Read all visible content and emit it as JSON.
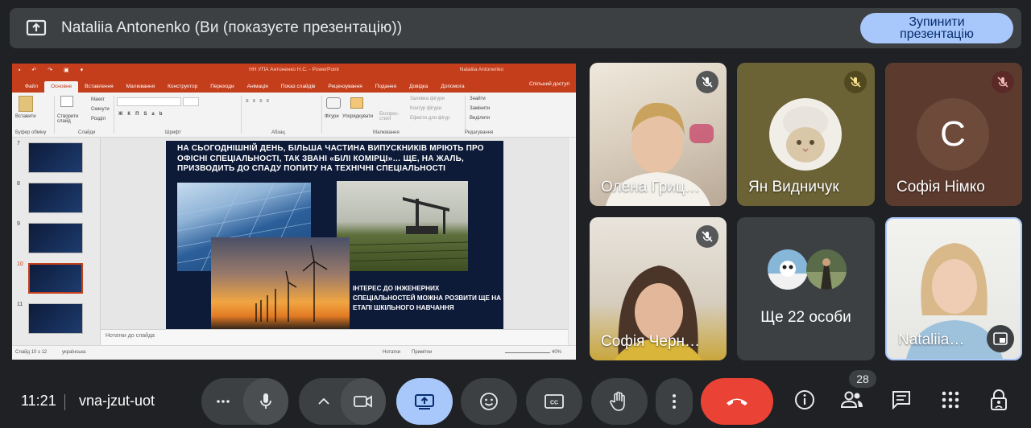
{
  "banner": {
    "title": "Nataliia Antonenko (Ви (показуєте презентацію))",
    "stop_button": "Зупинити презентацію",
    "icon": "present-to-all-icon"
  },
  "ppt": {
    "window_title": "НН УПА Антоненко Н.С.  -  PowerPoint",
    "user": "Nataliia Antonenko",
    "tabs": [
      "Файл",
      "Основне",
      "Вставлення",
      "Малювання",
      "Конструктор",
      "Переходи",
      "Анімація",
      "Показ слайдів",
      "Рецензування",
      "Подання",
      "Довідка",
      "Допомога"
    ],
    "share_label": "Спільний доступ",
    "ribbon": {
      "paste": "Вставити",
      "new_slide": "Створити слайд",
      "layout": "Макет",
      "reset": "Скинути",
      "section": "Розділ",
      "shapes": "Фігури",
      "arrange": "Упорядкувати",
      "quick_styles": "Експрес-стилі",
      "fill": "Заливка фігури",
      "outline": "Контур фігури",
      "effects": "Ефекти для фігур",
      "find": "Знайти",
      "replace": "Замінити",
      "select": "Виділити",
      "groups": [
        "Буфер обміну",
        "Слайди",
        "Шрифт",
        "Абзац",
        "Малювання",
        "Редагування"
      ]
    },
    "thumb_numbers": [
      "7",
      "8",
      "9",
      "10",
      "11"
    ],
    "slide_text": "НА СЬОГОДНІШНІЙ ДЕНЬ, БІЛЬША ЧАСТИНА ВИПУСКНИКІВ МРІЮТЬ ПРО ОФІСНІ СПЕЦІАЛЬНОСТІ, ТАК ЗВАНІ «БІЛІ КОМІРЦІ»… ЩЕ, НА ЖАЛЬ, ПРИЗВОДИТЬ ДО СПАДУ ПОПИТУ НА ТЕХНІЧНІ СПЕЦІАЛЬНОСТІ",
    "slide_caption": "ІНТЕРЕС ДО ІНЖЕНЕРНИХ СПЕЦІАЛЬНОСТЕЙ МОЖНА РОЗВИТИ ЩЕ НА ЕТАПІ ШКІЛЬНОГО НАВЧАННЯ",
    "notes_placeholder": "Нотатки до слайда",
    "status": {
      "slide": "Слайд 10 з 12",
      "language": "українська",
      "notes": "Нотатки",
      "comments": "Примітки",
      "zoom": "40%"
    }
  },
  "participants": [
    {
      "name": "Олена Гриц…",
      "muted": true
    },
    {
      "name": "Ян Видничук",
      "muted": true,
      "avatar": "cat-avatar"
    },
    {
      "name": "Софія Німко",
      "muted": true,
      "initial": "С"
    },
    {
      "name": "Софія Черн…",
      "muted": true
    },
    {
      "name": "Ще 22 особи",
      "muted": false
    },
    {
      "name": "Nataliia…",
      "muted": false
    }
  ],
  "bottom": {
    "time": "11:21",
    "meeting_code": "vna-jzut-uot",
    "participants_count": "28"
  },
  "colors": {
    "bg": "#202124",
    "tile": "#3c4043",
    "accent": "#a8c7fa",
    "end_call": "#ea4335",
    "ppt": "#c43e1c"
  }
}
